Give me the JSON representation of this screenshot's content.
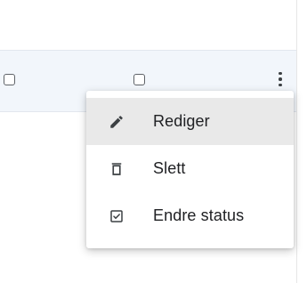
{
  "menu": {
    "items": [
      {
        "label": "Rediger",
        "icon": "pencil-icon",
        "highlighted": true
      },
      {
        "label": "Slett",
        "icon": "trash-icon",
        "highlighted": false
      },
      {
        "label": "Endre status",
        "icon": "checkbox-checked-icon",
        "highlighted": false
      }
    ]
  },
  "colors": {
    "row_background": "#f2f6fb",
    "menu_hover": "#e9e9e9",
    "icon": "#3c4043",
    "text": "#202124"
  }
}
